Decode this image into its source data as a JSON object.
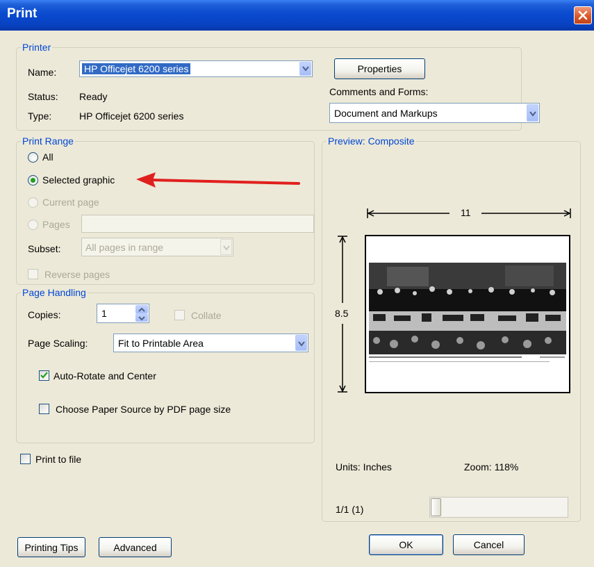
{
  "window": {
    "title": "Print"
  },
  "printer": {
    "group_label": "Printer",
    "name_label": "Name:",
    "name_value": "HP Officejet 6200 series",
    "status_label": "Status:",
    "status_value": "Ready",
    "type_label": "Type:",
    "type_value": "HP Officejet 6200 series",
    "properties_button": "Properties",
    "comments_label": "Comments and Forms:",
    "comments_value": "Document and Markups"
  },
  "print_range": {
    "group_label": "Print Range",
    "all_label": "All",
    "selected_label": "Selected graphic",
    "current_label": "Current page",
    "pages_label": "Pages",
    "pages_value": "",
    "subset_label": "Subset:",
    "subset_value": "All pages in range",
    "reverse_label": "Reverse pages",
    "selected_option": "Selected graphic"
  },
  "page_handling": {
    "group_label": "Page Handling",
    "copies_label": "Copies:",
    "copies_value": "1",
    "collate_label": "Collate",
    "scaling_label": "Page Scaling:",
    "scaling_value": "Fit to Printable Area",
    "autorotate_label": "Auto-Rotate and Center",
    "autorotate_checked": true,
    "paper_source_label": "Choose Paper Source by PDF page size",
    "paper_source_checked": false
  },
  "print_to_file": {
    "label": "Print to file",
    "checked": false
  },
  "preview": {
    "group_label": "Preview: Composite",
    "width_dimension": "11",
    "height_dimension": "8.5",
    "units_label": "Units: Inches",
    "zoom_label": "Zoom: 118%",
    "page_indicator": "1/1 (1)",
    "page_slider_position": 0
  },
  "buttons": {
    "printing_tips": "Printing Tips",
    "advanced": "Advanced",
    "ok": "OK",
    "cancel": "Cancel"
  },
  "annotation": {
    "arrow_color": "#E0201E"
  },
  "colors": {
    "title_bar": "#0A4BD0",
    "group_label": "#0046D5",
    "dialog_bg": "#ECE9D8"
  }
}
